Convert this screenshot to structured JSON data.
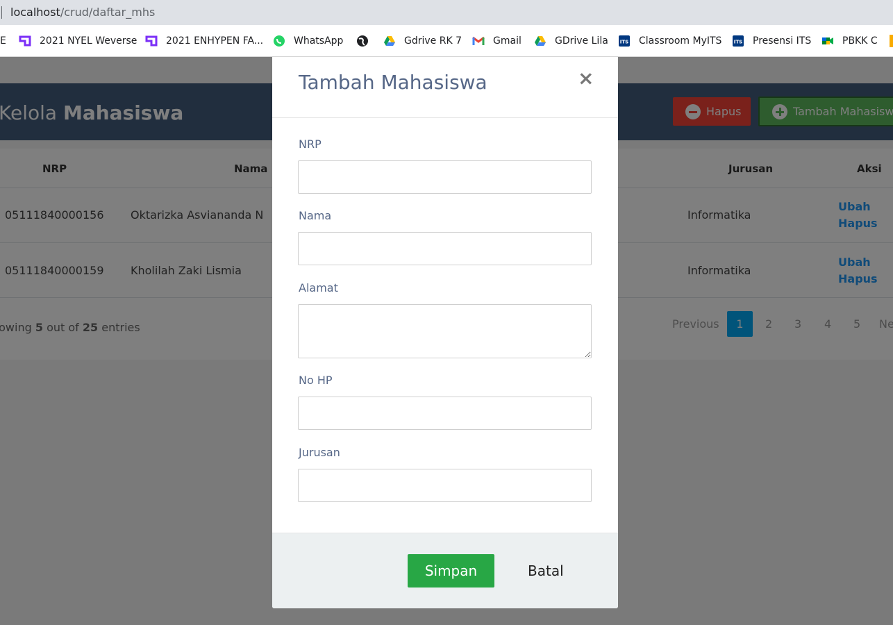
{
  "browser": {
    "url_host": "localhost",
    "url_path": "/crud/daftar_mhs",
    "bookmarks": [
      {
        "label": "E",
        "icon": "none"
      },
      {
        "label": "2021 NYEL Weverse",
        "icon": "weverse-icon"
      },
      {
        "label": "2021 ENHYPEN FA...",
        "icon": "weverse-icon"
      },
      {
        "label": "WhatsApp",
        "icon": "whatsapp-icon"
      },
      {
        "label": "",
        "icon": "globe-icon"
      },
      {
        "label": "Gdrive RK 7",
        "icon": "google-drive-icon"
      },
      {
        "label": "Gmail",
        "icon": "gmail-icon"
      },
      {
        "label": "GDrive Lila",
        "icon": "google-drive-icon"
      },
      {
        "label": "Classroom MyITS",
        "icon": "its-icon"
      },
      {
        "label": "Presensi ITS",
        "icon": "its-icon"
      },
      {
        "label": "PBKK C",
        "icon": "google-meet-icon"
      }
    ]
  },
  "page": {
    "title_light": "Kelola ",
    "title_bold": "Mahasiswa",
    "btn_hapus": "Hapus",
    "btn_tambah": "Tambah Mahasiswa",
    "columns": [
      "NRP",
      "Nama",
      "Jurusan",
      "Aksi"
    ],
    "rows": [
      {
        "nrp": "05111840000156",
        "nama": "Oktarizka Asviananda N",
        "jurusan": "Informatika",
        "ubah": "Ubah",
        "hapus": "Hapus"
      },
      {
        "nrp": "05111840000159",
        "nama": "Kholilah Zaki Lismia",
        "jurusan": "Informatika",
        "ubah": "Ubah",
        "hapus": "Hapus"
      }
    ],
    "showing_prefix": "howing ",
    "showing_count": "5",
    "showing_mid": " out of ",
    "showing_total": "25",
    "showing_suffix": " entries",
    "pagination": {
      "previous": "Previous",
      "pages": [
        "1",
        "2",
        "3",
        "4",
        "5"
      ],
      "next": "Ne",
      "active": "1"
    }
  },
  "modal": {
    "title": "Tambah Mahasiswa",
    "close": "×",
    "fields": {
      "nrp_label": "NRP",
      "nama_label": "Nama",
      "alamat_label": "Alamat",
      "nohp_label": "No HP",
      "jurusan_label": "Jurusan"
    },
    "btn_simpan": "Simpan",
    "btn_batal": "Batal"
  },
  "colors": {
    "header_bg": "#435d7d",
    "danger": "#f44336",
    "success": "#5cb85c",
    "primary": "#03a9f4",
    "simpan": "#28a745",
    "modal_title": "#566787"
  }
}
